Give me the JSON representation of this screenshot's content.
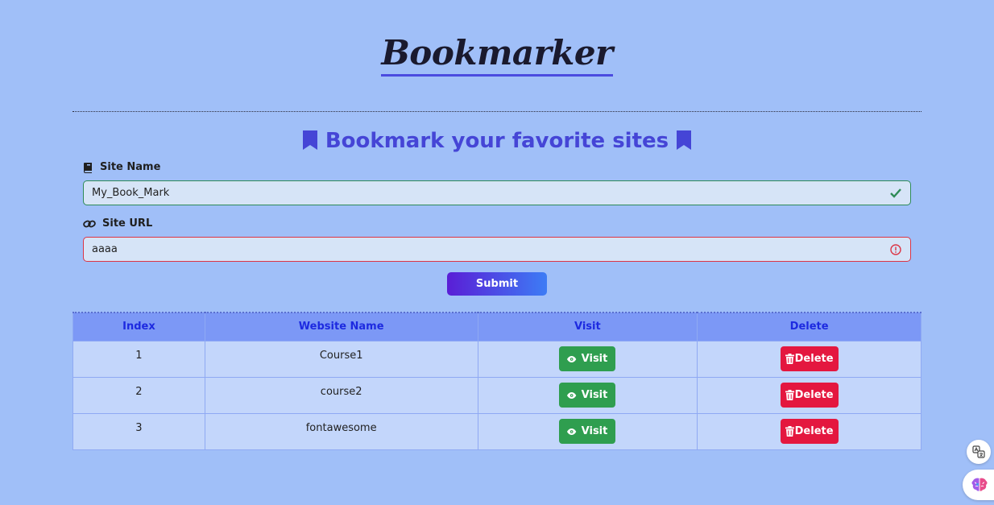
{
  "header": {
    "logo": "Bookmarker"
  },
  "form": {
    "title": "Bookmark your favorite sites",
    "site_name_label": "Site Name",
    "site_name_value": "My_Book_Mark",
    "site_url_label": "Site URL",
    "site_url_value": "aaaa",
    "submit_label": "Submit"
  },
  "table": {
    "headers": [
      "Index",
      "Website Name",
      "Visit",
      "Delete"
    ],
    "rows": [
      {
        "index": "1",
        "name": "Course1",
        "visit": "Visit",
        "delete": "Delete"
      },
      {
        "index": "2",
        "name": "course2",
        "visit": "Visit",
        "delete": "Delete"
      },
      {
        "index": "3",
        "name": "fontawesome",
        "visit": "Visit",
        "delete": "Delete"
      }
    ]
  },
  "icons": {
    "bookmark": "bookmark-icon",
    "book": "book-icon",
    "link": "link-icon",
    "check": "check-icon",
    "error": "error-icon",
    "eye": "eye-icon",
    "trash": "trash-icon",
    "translate": "translate-icon",
    "brain": "brain-icon"
  },
  "colors": {
    "background": "#a0bff8",
    "accent": "#4545d6",
    "visit": "#2f9e4f",
    "delete": "#e4173f"
  }
}
